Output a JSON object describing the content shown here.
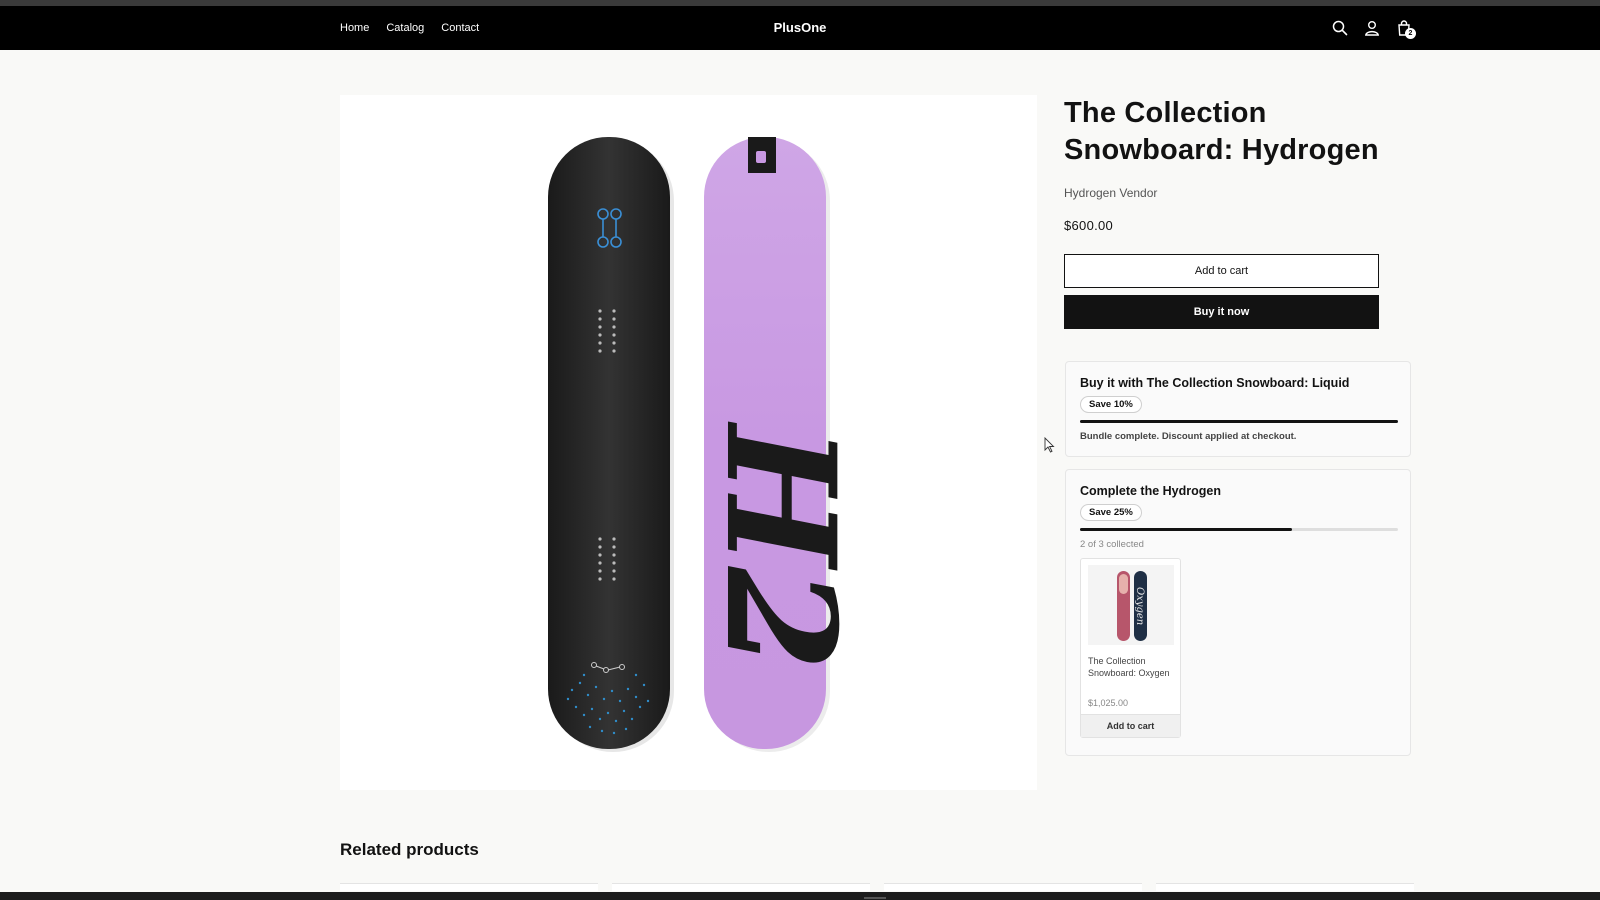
{
  "header": {
    "logo": "PlusOne",
    "nav": [
      "Home",
      "Catalog",
      "Contact"
    ],
    "icons": [
      "search-icon",
      "account-icon",
      "cart-icon"
    ],
    "cart_count": "2"
  },
  "product": {
    "title": "The Collection Snowboard: Hydrogen",
    "vendor": "Hydrogen Vendor",
    "price": "$600.00",
    "add_to_cart": "Add to cart",
    "buy_now": "Buy it now",
    "image_text": "H2"
  },
  "bundles": [
    {
      "title": "Buy it with The Collection Snowboard: Liquid",
      "badge": "Save 10%",
      "progress": 1.0,
      "note": "Bundle complete. Discount applied at checkout."
    },
    {
      "title": "Complete the Hydrogen",
      "badge": "Save 25%",
      "progress": 0.6667,
      "note": "2 of 3 collected",
      "item": {
        "name": "The Collection Snowboard: Oxygen",
        "price": "$1,025.00",
        "button": "Add to cart",
        "image_text": "Oxygen"
      }
    }
  ],
  "related": {
    "heading": "Related products"
  },
  "colors": {
    "header_bg": "#000000",
    "accent": "#121212",
    "page_bg": "#f9f9f7",
    "board_purple": "#c79ae0",
    "board_black": "#2a2a2a"
  }
}
